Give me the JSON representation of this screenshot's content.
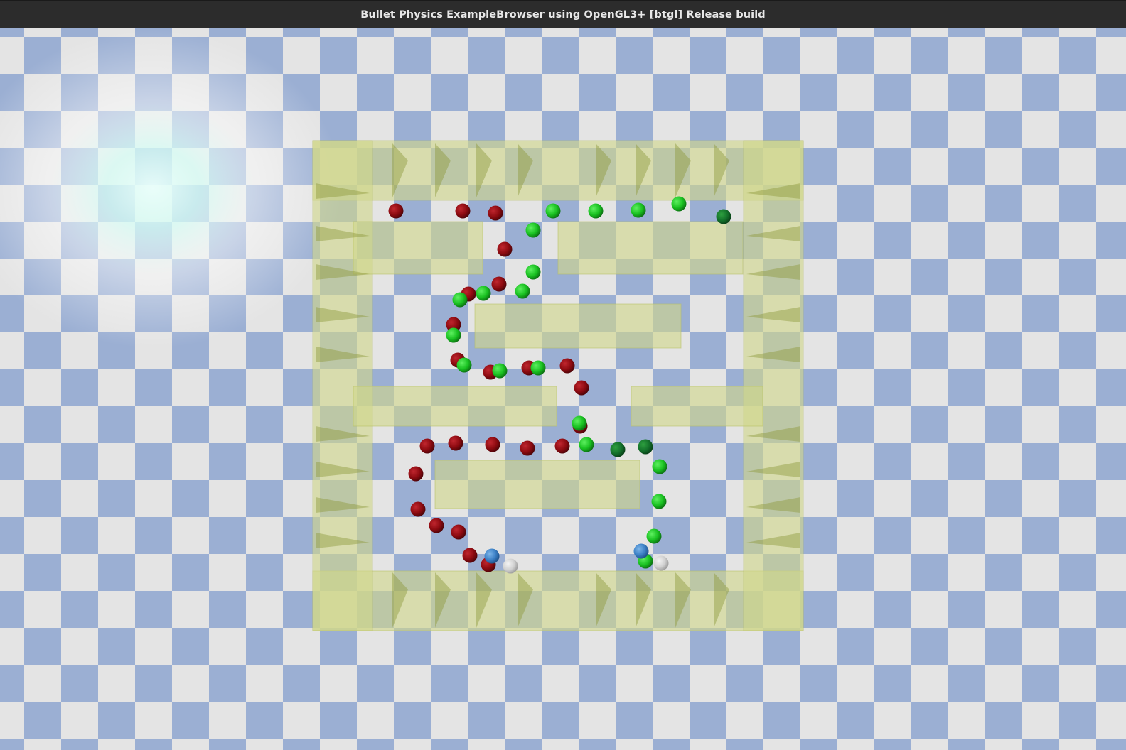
{
  "window": {
    "title": "Bullet Physics ExampleBrowser using OpenGL3+ [btgl] Release build"
  },
  "scene": {
    "floor_colors": {
      "light": "#e4e4e4",
      "dark": "#9bafd3"
    },
    "wall_color": "#d2d88c",
    "light_glow_color": "#d8fff6",
    "sphere_colors": {
      "red": "#8c0a10",
      "green": "#18c020",
      "blue": "#3a7ec4",
      "grey": "#d0d0d0"
    }
  }
}
